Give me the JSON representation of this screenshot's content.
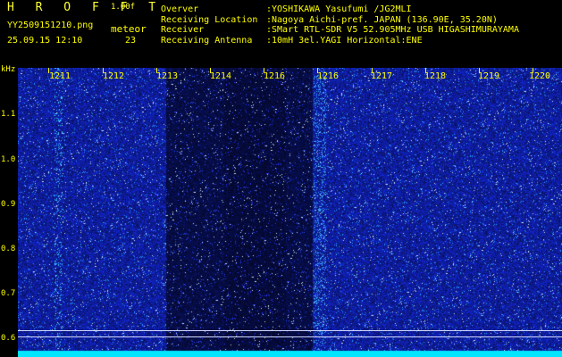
{
  "header": {
    "brand": "H R O F F T",
    "version": "1.00f",
    "filename": "YY2509151210.png",
    "datetime": "25.09.15 12:10",
    "meteor_label": "meteor",
    "meteor_count": "23",
    "info": [
      {
        "key": "Overver",
        "value": ":YOSHIKAWA Yasufumi /JG2MLI"
      },
      {
        "key": "Receiving Location",
        "value": ":Nagoya Aichi-pref. JAPAN (136.90E, 35.20N)"
      },
      {
        "key": "Receiver",
        "value": ":SMart RTL-SDR V5 52.905MHz USB HIGASHIMURAYAMA"
      },
      {
        "key": "Receiving Antenna",
        "value": ":10mH 3el.YAGI Horizontal:ENE"
      }
    ]
  },
  "spectrogram": {
    "y_unit": "kHz",
    "y_ticks": [
      "1.1",
      "1.0",
      "0.9",
      "0.8",
      "0.7",
      "0.6"
    ],
    "x_ticks": [
      "1211",
      "1212",
      "1213",
      "1214",
      "1216",
      "1216",
      "1217",
      "1218",
      "1219",
      "1220"
    ],
    "colors": {
      "background": "#000000",
      "noise": "#1a2bd6",
      "signal": "#00e5ff",
      "text": "#ffff00"
    }
  }
}
